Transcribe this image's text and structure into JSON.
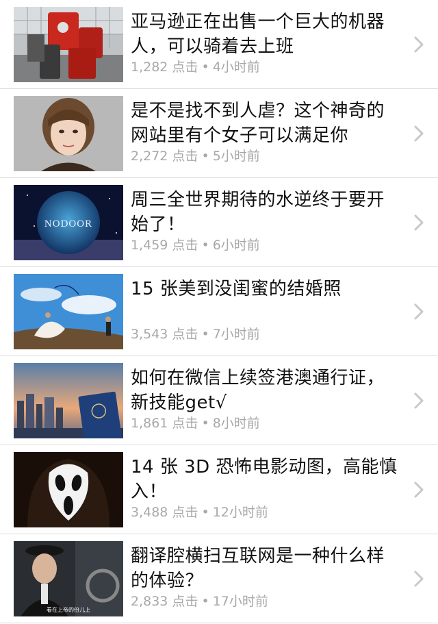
{
  "articles": [
    {
      "title": "亚马逊正在出售一个巨大的机器人，可以骑着去上班",
      "clicks": "1,282",
      "click_label": "点击",
      "separator": "•",
      "time": "4小时前",
      "thumb_icon": "robot-thumbnail"
    },
    {
      "title": "是不是找不到人虐？这个神奇的网站里有个女子可以满足你",
      "clicks": "2,272",
      "click_label": "点击",
      "separator": "•",
      "time": "5小时前",
      "thumb_icon": "woman-portrait-thumbnail"
    },
    {
      "title": "周三全世界期待的水逆终于要开始了！",
      "clicks": "1,459",
      "click_label": "点击",
      "separator": "•",
      "time": "6小时前",
      "thumb_icon": "nodoor-planet-thumbnail",
      "thumb_text": "NODOOR"
    },
    {
      "title": "15 张美到没闺蜜的结婚照",
      "clicks": "3,543",
      "click_label": "点击",
      "separator": "•",
      "time": "7小时前",
      "thumb_icon": "wedding-photo-thumbnail"
    },
    {
      "title": "如何在微信上续签港澳通行证，新技能get√",
      "clicks": "1,861",
      "click_label": "点击",
      "separator": "•",
      "time": "8小时前",
      "thumb_icon": "passport-skyline-thumbnail"
    },
    {
      "title": "14 张 3D 恐怖电影动图，高能慎入！",
      "clicks": "3,488",
      "click_label": "点击",
      "separator": "•",
      "time": "12小时前",
      "thumb_icon": "scream-mask-thumbnail"
    },
    {
      "title": "翻译腔横扫互联网是一种什么样的体验？",
      "clicks": "2,833",
      "click_label": "点击",
      "separator": "•",
      "time": "17小时前",
      "thumb_icon": "movie-still-thumbnail",
      "thumb_caption": "看在上帝的份儿上"
    }
  ],
  "colors": {
    "title": "#111111",
    "meta": "#a8a8a8",
    "divider": "#dcdcdc",
    "chevron": "#c7c7cc"
  }
}
